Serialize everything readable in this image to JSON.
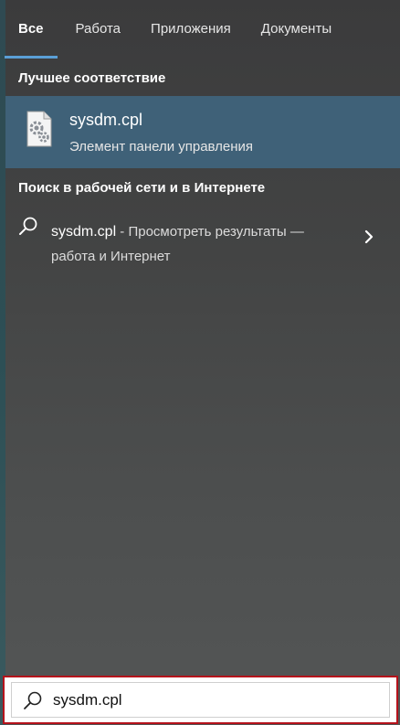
{
  "tabs": [
    {
      "label": "Все",
      "active": true
    },
    {
      "label": "Работа",
      "active": false
    },
    {
      "label": "Приложения",
      "active": false
    },
    {
      "label": "Документы",
      "active": false
    }
  ],
  "best_match": {
    "header": "Лучшее соответствие",
    "title": "sysdm.cpl",
    "subtitle": "Элемент панели управления",
    "icon": "control-panel-file-icon"
  },
  "web_search": {
    "header": "Поиск в рабочей сети и в Интернете",
    "query": "sysdm.cpl",
    "suffix": " - Просмотреть результаты —",
    "suffix_line2": "работа и Интернет",
    "icon": "search-icon",
    "arrow_icon": "chevron-right-icon"
  },
  "search_bar": {
    "value": "sysdm.cpl",
    "icon": "search-icon"
  },
  "colors": {
    "accent": "#5a9fd6",
    "selected_row": "#3f6178",
    "highlight_border": "#b5121b"
  }
}
